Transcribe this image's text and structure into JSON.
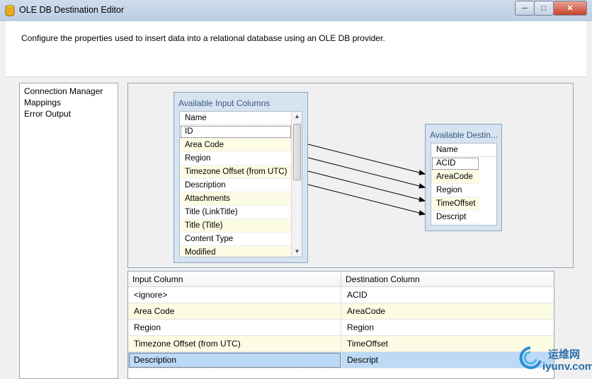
{
  "window": {
    "title": "OLE DB Destination Editor"
  },
  "header": {
    "description": "Configure the properties used to insert data into a relational database using an OLE DB provider."
  },
  "nav": {
    "items": [
      "Connection Manager",
      "Mappings",
      "Error Output"
    ]
  },
  "input_box": {
    "title": "Available Input Columns",
    "header": "Name",
    "rows": [
      "ID",
      "Area Code",
      "Region",
      "Timezone Offset (from UTC)",
      "Description",
      "Attachments",
      "Title (LinkTitle)",
      "Title (Title)",
      "Content Type",
      "Modified"
    ]
  },
  "dest_box": {
    "title": "Available Destin...",
    "header": "Name",
    "rows": [
      "ACID",
      "AreaCode",
      "Region",
      "TimeOffset",
      "Descript"
    ]
  },
  "grid": {
    "headers": [
      "Input Column",
      "Destination Column"
    ],
    "rows": [
      {
        "input": "<ignore>",
        "dest": "ACID"
      },
      {
        "input": "Area Code",
        "dest": "AreaCode"
      },
      {
        "input": "Region",
        "dest": "Region"
      },
      {
        "input": "Timezone Offset (from UTC)",
        "dest": "TimeOffset"
      },
      {
        "input": "Description",
        "dest": "Descript"
      }
    ]
  },
  "watermark": {
    "cn": "运维网",
    "url": "iyunv.com"
  },
  "colors": {
    "accent": "#bcd9f5",
    "alt_row": "#fcfbe3",
    "box_bg": "#d6e3f0"
  }
}
